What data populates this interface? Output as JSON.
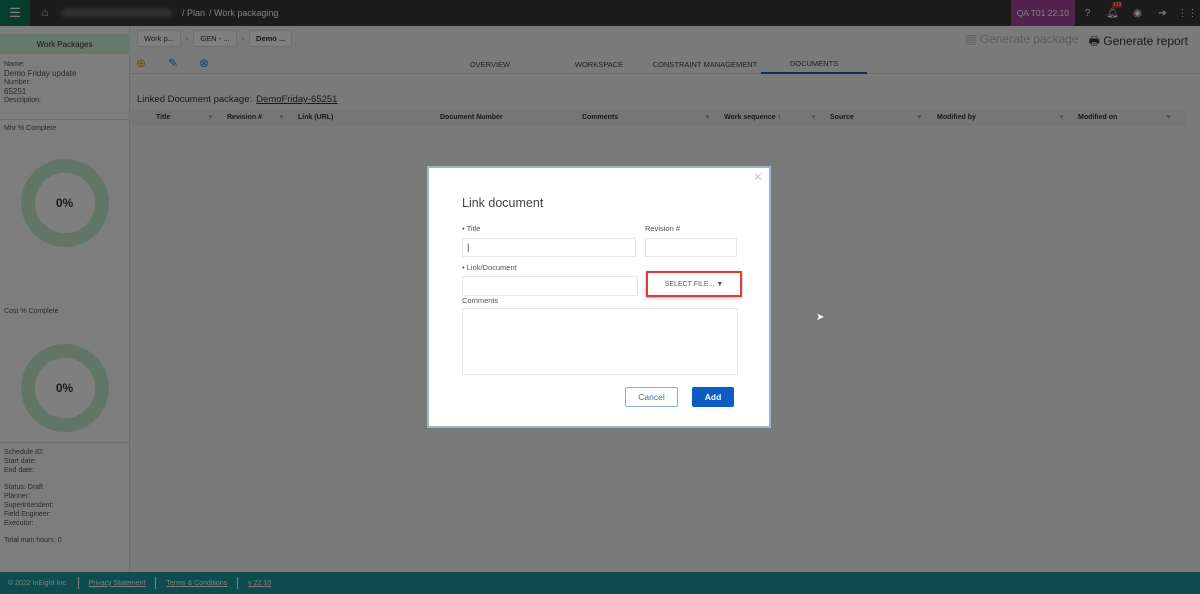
{
  "topbar": {
    "breadcrumb": [
      "/ Plan",
      "/ Work packaging"
    ],
    "env": "QA T01 22.10",
    "notification_count": "133"
  },
  "sidebar": {
    "header": "Work Packages",
    "name_label": "Name:",
    "name": "Demo Friday update",
    "number_label": "Number:",
    "number": "65251",
    "description_label": "Description:",
    "mhr_label": "Mhr % Complete",
    "mhr_value": "0%",
    "cost_label": "Cost % Complete",
    "cost_value": "0%",
    "schedule_id": "Schedule ID:",
    "start_date": "Start date:",
    "end_date": "End date:",
    "status": "Status: Draft",
    "planner": "Planner:",
    "superintendent": "Superintendent:",
    "field_engineer": "Field Engineer:",
    "executor": "Executor:",
    "total_hours": "Total man hours: 0"
  },
  "main": {
    "breadcrumbs": [
      "Work p...",
      "GEN - ...",
      "Demo ..."
    ],
    "generate_package": "Generate package",
    "generate_report": "Generate report",
    "tabs": [
      "OVERVIEW",
      "WORKSPACE",
      "CONSTRAINT MANAGEMENT",
      "DOCUMENTS"
    ],
    "active_tab": "DOCUMENTS",
    "linked_label": "Linked Document package:",
    "linked_value": "DemoFriday-65251",
    "columns": [
      "Title",
      "Revision #",
      "Link (URL)",
      "Document Number",
      "Comments",
      "Work sequence ↑",
      "Source",
      "Modified by",
      "Modified on"
    ]
  },
  "modal": {
    "title": "Link document",
    "title_label": "• Title",
    "title_value": "|",
    "revision_label": "Revision #",
    "link_label": "• Link/Document",
    "select_file": "SELECT FILE...  ▼",
    "comments_label": "Comments",
    "cancel": "Cancel",
    "add": "Add"
  },
  "footer": {
    "copyright": "© 2022 InEight Inc.",
    "privacy": "Privacy Statement",
    "terms": "Terms & Conditions",
    "version": "v 22.10"
  },
  "colors": {
    "accent": "#0b5cc4",
    "highlight": "#e53935",
    "env_badge": "#a4479a",
    "footer": "#1a9a9e"
  }
}
